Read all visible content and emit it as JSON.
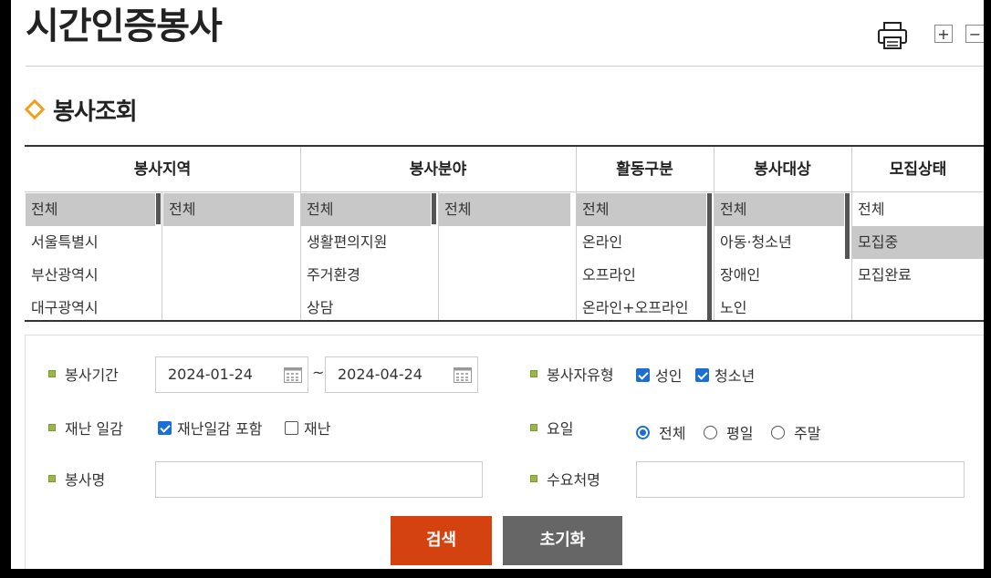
{
  "page": {
    "title": "시간인증봉사"
  },
  "toolbar": {
    "zoom_in": "+",
    "zoom_out": "−"
  },
  "section": {
    "title": "봉사조회"
  },
  "filters": {
    "region": {
      "header": "봉사지역",
      "items": [
        "전체",
        "서울특별시",
        "부산광역시",
        "대구광역시"
      ],
      "sub_items": [
        "전체"
      ]
    },
    "field": {
      "header": "봉사분야",
      "items": [
        "전체",
        "생활편의지원",
        "주거환경",
        "상담"
      ],
      "sub_items": [
        "전체"
      ]
    },
    "activity": {
      "header": "활동구분",
      "items": [
        "전체",
        "온라인",
        "오프라인",
        "온라인+오프라인"
      ]
    },
    "target": {
      "header": "봉사대상",
      "items": [
        "전체",
        "아동·청소년",
        "장애인",
        "노인"
      ]
    },
    "status": {
      "header": "모집상태",
      "items": [
        "전체",
        "모집중",
        "모집완료"
      ]
    }
  },
  "form": {
    "period": {
      "label": "봉사기간",
      "start": "2024-01-24",
      "separator": "~",
      "end": "2024-04-24"
    },
    "volunteer_type": {
      "label": "봉사자유형",
      "adult": "성인",
      "youth": "청소년"
    },
    "disaster": {
      "label": "재난 일감",
      "include": "재난일감 포함",
      "only": "재난"
    },
    "day": {
      "label": "요일",
      "all": "전체",
      "weekday": "평일",
      "weekend": "주말"
    },
    "name": {
      "label": "봉사명",
      "value": ""
    },
    "org": {
      "label": "수요처명",
      "value": ""
    }
  },
  "buttons": {
    "search": "검색",
    "reset": "초기화"
  },
  "colors": {
    "search_button": "#d4420f",
    "reset_button": "#666666",
    "accent_diamond": "#f0a020",
    "checkbox": "#1a6fd6"
  }
}
